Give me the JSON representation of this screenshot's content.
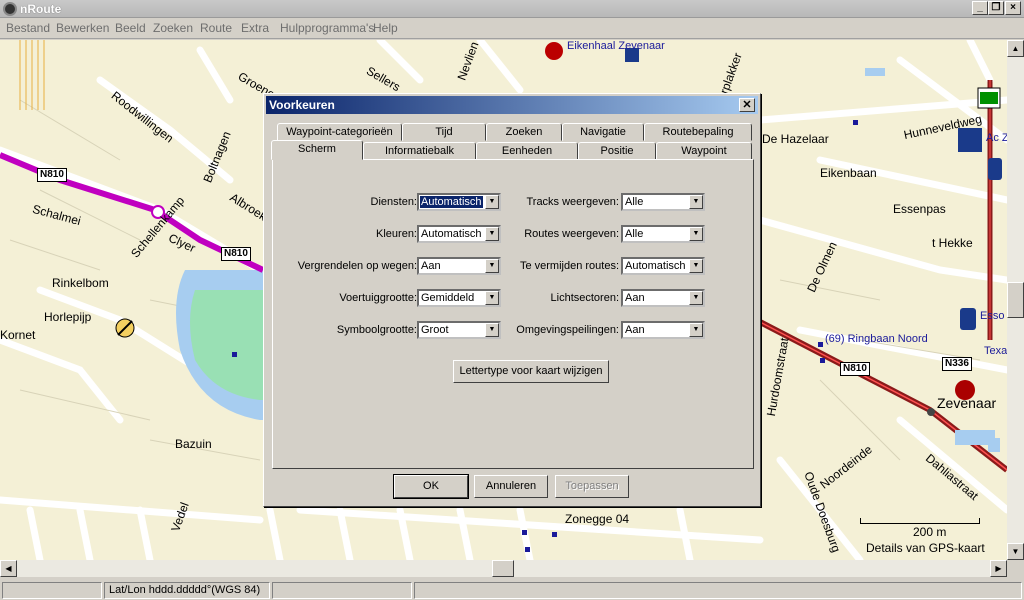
{
  "app": {
    "title": "nRoute"
  },
  "menu": [
    "Bestand",
    "Bewerken",
    "Beeld",
    "Zoeken",
    "Route",
    "Extra",
    "Hulpprogramma's",
    "Help"
  ],
  "map": {
    "streets": [
      "Eikenhaal Zevenaar",
      "Roodwillingen",
      "Boltnagen",
      "Albroek",
      "Groenen",
      "Nevlien",
      "Sellers",
      "Visserplakker",
      "Schalmei",
      "Schellenkamp",
      "Clyer",
      "Rinkelbom",
      "Horlepijp",
      "Kornet",
      "Bazuin",
      "Vedel",
      "Zonegge 04",
      "De Hazelaar",
      "Hunneveldweg",
      "Eikenbaan",
      "Essenpas",
      "t Hekke",
      "De Olmen",
      "Hurdoomstraat",
      "Noordeinde",
      "Dahliastraat",
      "Oude Doesburg",
      "Zevenaar",
      "(69) Ringbaan Noord",
      "Esso",
      "Texa",
      "Ac Z"
    ],
    "road_badges": [
      "N810",
      "N810",
      "N810",
      "N336"
    ],
    "scale": {
      "label": "200 m"
    },
    "detail_text": "Details van GPS-kaart"
  },
  "status": {
    "coords": "Lat/Lon hddd.ddddd°(WGS 84)"
  },
  "dialog": {
    "title": "Voorkeuren",
    "tabs_row1": [
      "Waypoint-categorieën",
      "Tijd",
      "Zoeken",
      "Navigatie",
      "Routebepaling"
    ],
    "tabs_row2": [
      "Scherm",
      "Informatiebalk",
      "Eenheden",
      "Positie",
      "Waypoint"
    ],
    "active_tab": "Scherm",
    "left_fields": [
      {
        "label": "Diensten:",
        "value": "Automatisch",
        "selected": true
      },
      {
        "label": "Kleuren:",
        "value": "Automatisch"
      },
      {
        "label": "Vergrendelen op wegen:",
        "value": "Aan"
      },
      {
        "label": "Voertuiggrootte:",
        "value": "Gemiddeld"
      },
      {
        "label": "Symboolgrootte:",
        "value": "Groot"
      }
    ],
    "right_fields": [
      {
        "label": "Tracks weergeven:",
        "value": "Alle"
      },
      {
        "label": "Routes weergeven:",
        "value": "Alle"
      },
      {
        "label": "Te vermijden routes:",
        "value": "Automatisch"
      },
      {
        "label": "Lichtsectoren:",
        "value": "Aan"
      },
      {
        "label": "Omgevingspeilingen:",
        "value": "Aan"
      }
    ],
    "font_button": "Lettertype voor kaart wijzigen",
    "ok": "OK",
    "cancel": "Annuleren",
    "apply": "Toepassen"
  }
}
